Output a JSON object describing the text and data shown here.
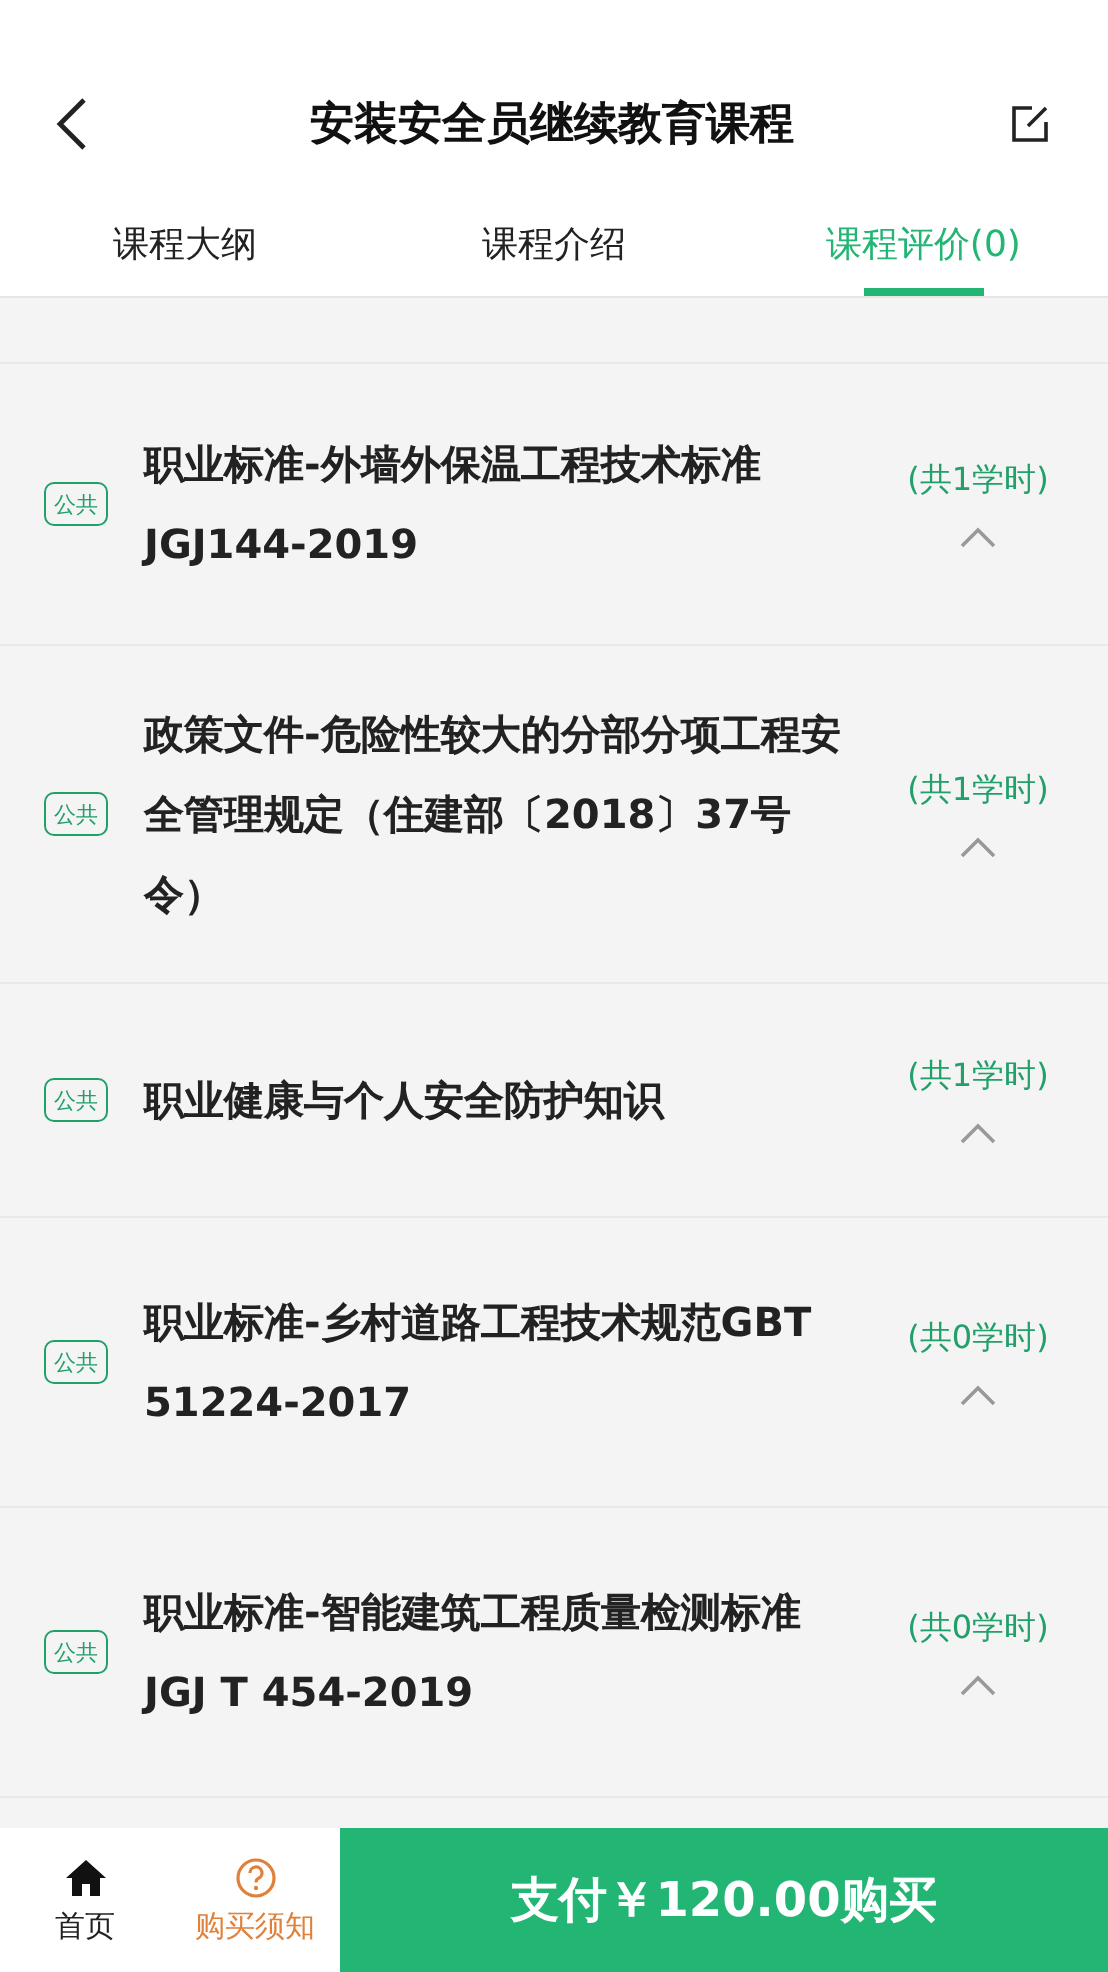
{
  "header": {
    "title": "安装安全员继续教育课程"
  },
  "tabs": [
    {
      "label": "课程大纲",
      "selected": false
    },
    {
      "label": "课程介绍",
      "selected": false
    },
    {
      "label": "课程评价(0)",
      "selected": true
    }
  ],
  "courses": [
    {
      "tag": "公共",
      "title": "职业标准-外墙外保温工程技术标准JGJ144-2019",
      "hours": "(共1学时)",
      "expanded": true
    },
    {
      "tag": "公共",
      "title": "政策文件-危险性较大的分部分项工程安全管理规定（住建部〔2018〕37号令）",
      "hours": "(共1学时)",
      "expanded": true
    },
    {
      "tag": "公共",
      "title": "职业健康与个人安全防护知识",
      "hours": "(共1学时)",
      "expanded": true
    },
    {
      "tag": "公共",
      "title": "职业标准-乡村道路工程技术规范GBT 51224-2017",
      "hours": "(共0学时)",
      "expanded": true
    },
    {
      "tag": "公共",
      "title": "职业标准-智能建筑工程质量检测标准JGJ T 454-2019",
      "hours": "(共0学时)",
      "expanded": true
    }
  ],
  "bottom_bar": {
    "items": [
      {
        "kind": "home",
        "label": "首页"
      },
      {
        "kind": "help",
        "label": "购买须知"
      }
    ],
    "pay_button": "支付￥120.00购买"
  }
}
